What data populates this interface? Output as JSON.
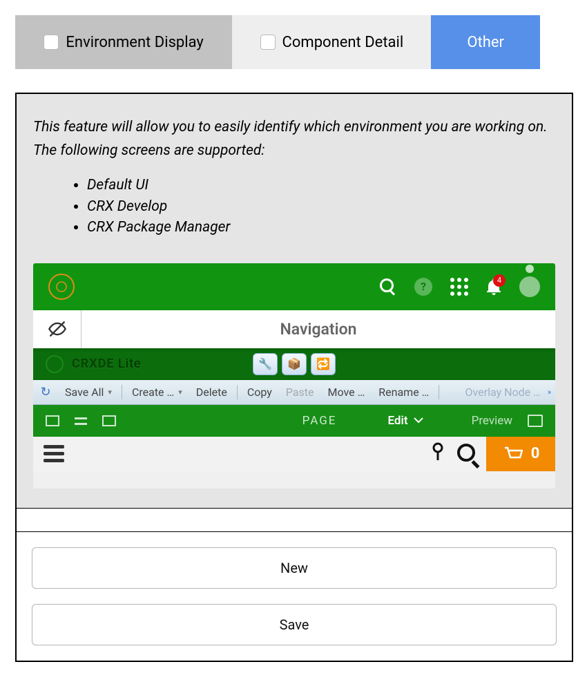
{
  "tabs": {
    "env": "Environment Display",
    "comp": "Component Detail",
    "other": "Other"
  },
  "description": "This feature will allow you to easily identify which environment you are working on. The following screens are supported:",
  "supported": [
    "Default UI",
    "CRX Develop",
    "CRX Package Manager"
  ],
  "shot": {
    "notifCount": "4",
    "navTitle": "Navigation",
    "crxde": "CRXDE",
    "lite": "Lite",
    "toolbar": {
      "saveAll": "Save All",
      "create": "Create …",
      "delete": "Delete",
      "copy": "Copy",
      "paste": "Paste",
      "move": "Move …",
      "rename": "Rename …",
      "overlay": "Overlay Node …"
    },
    "page": "PAGE",
    "edit": "Edit",
    "preview": "Preview",
    "cartCount": "0"
  },
  "buttons": {
    "new": "New",
    "save": "Save"
  }
}
